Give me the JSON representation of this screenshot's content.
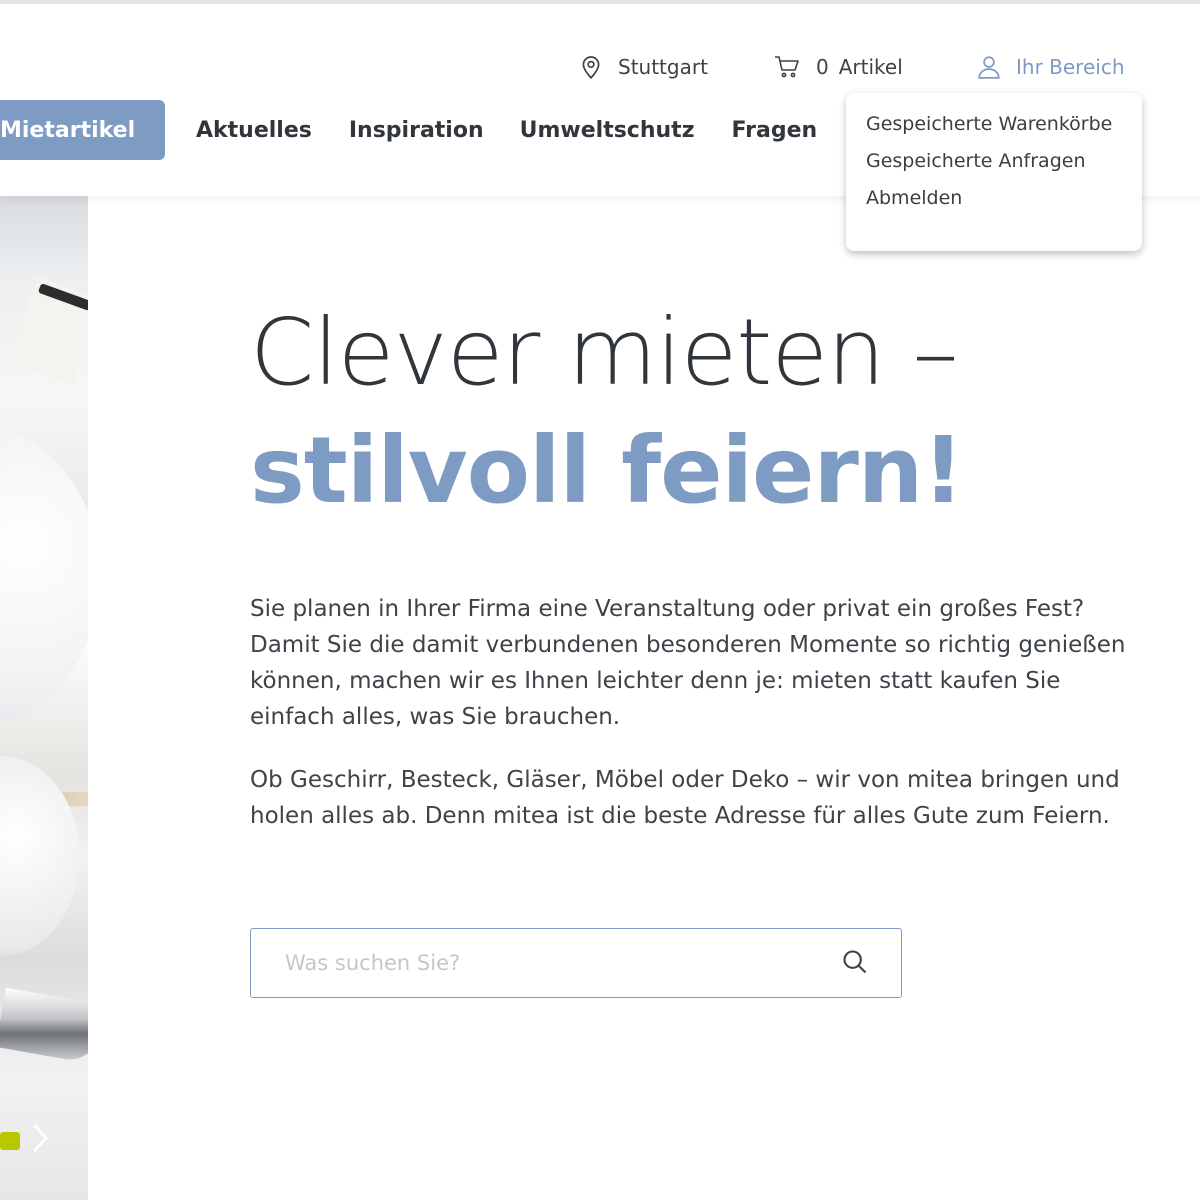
{
  "header": {
    "location": {
      "icon": "map-pin-icon",
      "label": "Stuttgart"
    },
    "cart": {
      "icon": "cart-icon",
      "count": "0",
      "label": "Artikel"
    },
    "account": {
      "icon": "user-icon",
      "label": "Ihr Bereich",
      "color": "#7e9bc4"
    }
  },
  "nav": {
    "items": [
      {
        "label": "Mietartikel",
        "active": true
      },
      {
        "label": "Aktuelles"
      },
      {
        "label": "Inspiration"
      },
      {
        "label": "Umweltschutz"
      },
      {
        "label": "Fragen"
      }
    ],
    "active_color": "#7e9bc4"
  },
  "account_menu": {
    "items": [
      {
        "label": "Gespeicherte Warenkörbe"
      },
      {
        "label": "Gespeicherte Anfragen"
      },
      {
        "label": "Abmelden"
      }
    ]
  },
  "hero": {
    "headline_line1": "Clever mieten –",
    "headline_line2": "stilvoll feiern!",
    "paragraph1": "Sie planen in Ihrer Firma eine Veranstaltung oder privat ein großes Fest? Damit Sie die damit verbundenen besonderen Momente so richtig genießen können, machen wir es Ihnen leichter denn je: mieten statt kaufen Sie einfach alles, was Sie brauchen.",
    "paragraph2": "Ob Geschirr, Besteck, Gläser, Möbel oder Deko – wir von mitea bringen und holen alles ab. Denn mitea ist die beste Adresse für alles Gute zum Feiern."
  },
  "search": {
    "value": "",
    "placeholder": "Was suchen Sie?",
    "icon": "search-icon"
  },
  "slider": {
    "dot_color": "#b8c800",
    "next_icon": "chevron-right-icon"
  }
}
